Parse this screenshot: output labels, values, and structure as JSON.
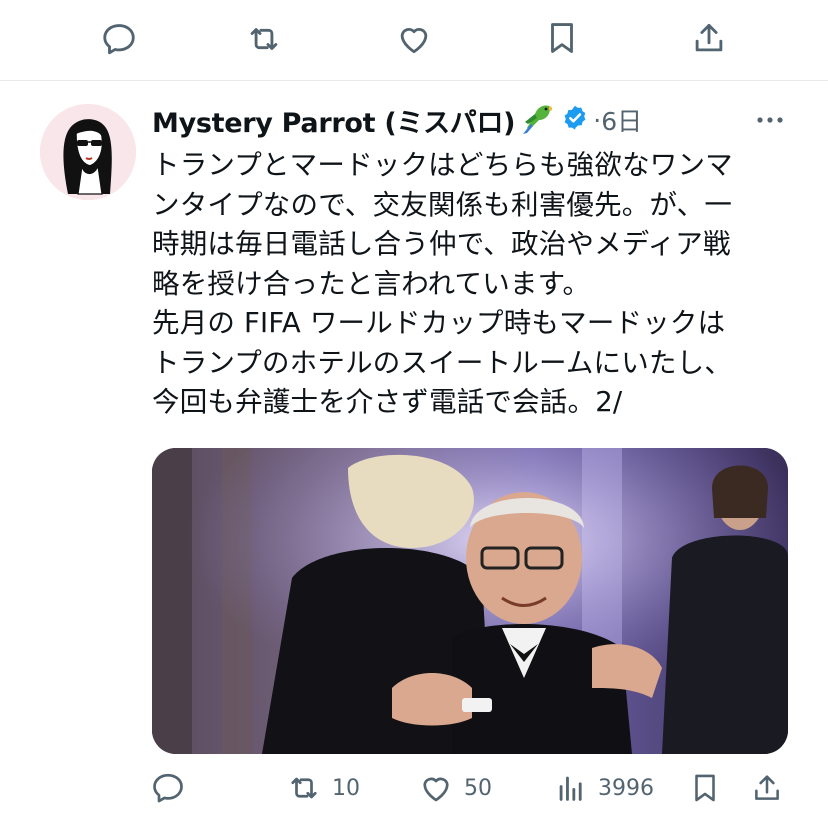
{
  "top_actions": {
    "reply_icon": "reply-icon",
    "retweet_icon": "retweet-icon",
    "like_icon": "like-icon",
    "bookmark_icon": "bookmark-icon",
    "share_icon": "share-icon"
  },
  "tweet": {
    "author": "Mystery Parrot (ミスパロ)",
    "author_emoji_icon": "parrot-icon",
    "verified_icon": "verified-badge-icon",
    "separator": "·",
    "time": "6日",
    "more_icon": "more-icon",
    "text": "トランプとマードックはどちらも強欲なワンマ\nンタイプなので、交友関係も利害優先。が、一\n時期は毎日電話し合う仲で、政治やメディア戦\n略を授け合ったと言われています。\n先月の FIFA ワールドカップ時もマードックは\nトランプのホテルのスイートルームにいたし、\n今回も弁護士を介さず電話で会話。2/",
    "media_description_icon": "photo-two-men-embracing",
    "stats": {
      "replies": "",
      "retweets": "10",
      "likes": "50",
      "views": "3996"
    }
  },
  "colors": {
    "text": "#0f1419",
    "secondary": "#536471",
    "verified": "#1d9bf0",
    "divider": "#e6e9eb",
    "avatar_bg": "#f8e6ea"
  }
}
